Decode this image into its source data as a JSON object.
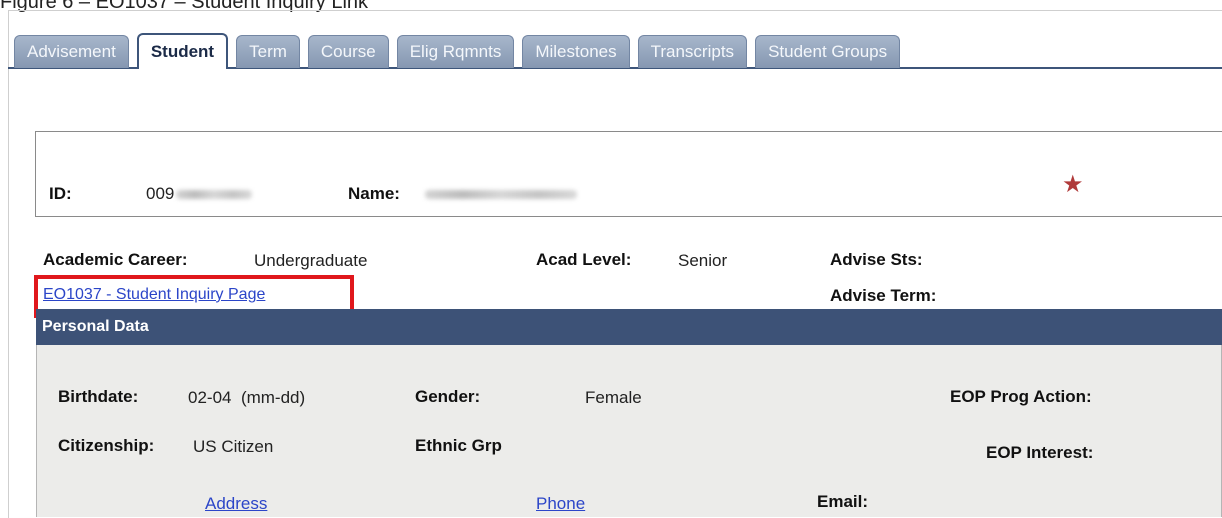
{
  "caption": "Figure 6 – EO1037 – Student Inquiry Link",
  "tabs": [
    {
      "label": "Advisement",
      "active": false
    },
    {
      "label": "Student",
      "active": true
    },
    {
      "label": "Term",
      "active": false
    },
    {
      "label": "Course",
      "active": false
    },
    {
      "label": "Elig Rqmnts",
      "active": false
    },
    {
      "label": "Milestones",
      "active": false
    },
    {
      "label": "Transcripts",
      "active": false
    },
    {
      "label": "Student Groups",
      "active": false
    }
  ],
  "id_box": {
    "id_label": "ID:",
    "id_value": "009",
    "name_label": "Name:"
  },
  "career": {
    "label": "Academic Career:",
    "value": "Undergraduate",
    "acad_level_label": "Acad Level:",
    "acad_level_value": "Senior",
    "advise_sts_label": "Advise Sts:",
    "advise_term_label": "Advise Term:",
    "inquiry_link": "EO1037 - Student Inquiry Page"
  },
  "personal": {
    "header": "Personal Data",
    "birthdate_label": "Birthdate:",
    "birthdate_value": "02-04",
    "birthdate_format": "(mm-dd)",
    "gender_label": "Gender:",
    "gender_value": "Female",
    "eop_prog_label": "EOP Prog Action:",
    "citizenship_label": "Citizenship:",
    "citizenship_value": "US Citizen",
    "ethnic_label": "Ethnic Grp",
    "eop_interest_label": "EOP Interest:",
    "address_link": "Address",
    "phone_link": "Phone",
    "email_label": "Email:"
  },
  "colors": {
    "tab_inactive": "#8c9db6",
    "tab_active_border": "#3d557a",
    "section_header": "#3d5277",
    "highlight": "#e0171c",
    "link": "#2b45c8",
    "star": "#b03a3a"
  },
  "icons": {
    "favorite": "star-icon"
  }
}
